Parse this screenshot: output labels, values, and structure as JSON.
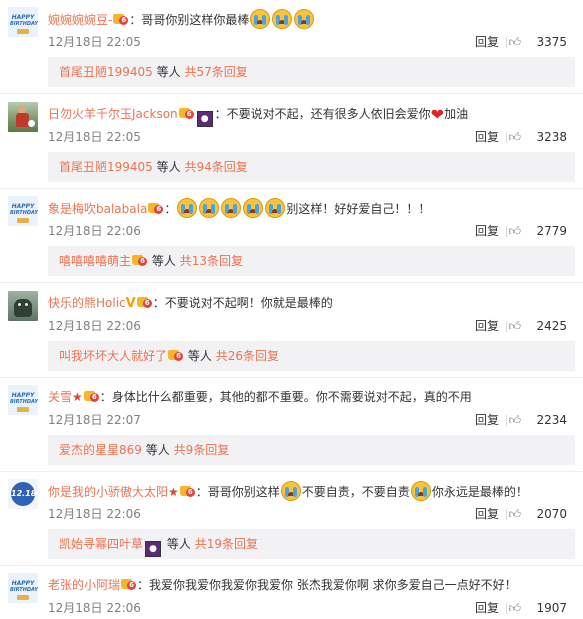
{
  "comments": [
    {
      "avatar": "happy-birthday-avatar",
      "username": "婉婉婉婉豆-",
      "badges": [
        "vip-crown"
      ],
      "vip_level": "6",
      "text": "：哥哥你别这样你最棒",
      "emoji_after": [
        "cry",
        "cry",
        "cry"
      ],
      "time": "12月18日 22:05",
      "reply": "回复",
      "likes": "3375",
      "sub": {
        "user": "首尾丑陋199405",
        "mid": "等人",
        "count": "共57条回复"
      }
    },
    {
      "avatar": "soccer-player-avatar",
      "username": "日勿火羊千尔玉Jackson",
      "badges": [
        "vip-crown",
        "square-icon"
      ],
      "vip_level": "6",
      "text": "：不要说对不起，还有很多人依旧会爱你",
      "after": "加油",
      "time": "12月18日 22:05",
      "reply": "回复",
      "likes": "3238",
      "sub": {
        "user": "首尾丑陋199405",
        "mid": "等人",
        "count": "共94条回复"
      }
    },
    {
      "avatar": "happy-birthday-avatar",
      "username": "象是梅吹balabala",
      "badges": [
        "vip-crown"
      ],
      "vip_level": "6",
      "text": "：",
      "after": "别这样！好好爱自己！！！",
      "time": "12月18日 22:06",
      "reply": "回复",
      "likes": "2779",
      "sub": {
        "user": "嘻嘻嘻嘻萌主",
        "mid": "等人",
        "count": "共13条回复"
      }
    },
    {
      "avatar": "monster-avatar",
      "username": "快乐的熊Holic",
      "badges": [
        "v-badge",
        "vip-crown"
      ],
      "vip_level": "6",
      "text": "：不要说对不起啊！你就是最棒的",
      "time": "12月18日 22:06",
      "reply": "回复",
      "likes": "2425",
      "sub": {
        "user": "叫我坏坏大人就好了",
        "mid": "等人",
        "count": "共26条回复"
      }
    },
    {
      "avatar": "happy-birthday-avatar",
      "username": "关雪",
      "badges": [
        "star",
        "vip-crown"
      ],
      "vip_level": "6",
      "text": "：身体比什么都重要，其他的都不重要。你不需要说对不起，真的不用",
      "time": "12月18日 22:07",
      "reply": "回复",
      "likes": "2234",
      "sub": {
        "user": "爱杰的星星869",
        "mid": "等人",
        "count": "共9条回复"
      }
    },
    {
      "avatar": "circle-avatar",
      "avatar_text": "12.18",
      "username": "你是我的小骄傲大太阳",
      "badges": [
        "star",
        "vip-crown"
      ],
      "vip_level": "6",
      "text": "：哥哥你别这样",
      "mid1": "不要自责，不要自责",
      "after": "你永远是最棒的！",
      "time": "12月18日 22:06",
      "reply": "回复",
      "likes": "2070",
      "sub": {
        "user": "凯始寻幂四叶草",
        "mid": "等人",
        "count": "共19条回复"
      }
    },
    {
      "avatar": "happy-birthday-avatar",
      "username": "老张的小阿瑞",
      "badges": [
        "vip-crown"
      ],
      "vip_level": "6",
      "text": "：我爱你我爱你我爱你我爱你 张杰我爱你啊 求你多爱自己一点好不好！",
      "time": "12月18日 22:06",
      "reply": "回复",
      "likes": "1907"
    }
  ],
  "avatar_text": {
    "happy_top": "HAPPY",
    "happy_bot": "BIRTHDAY"
  },
  "colors": {
    "username": "#eb7350",
    "sub_bg": "#f2f2f5",
    "time": "#808080"
  }
}
